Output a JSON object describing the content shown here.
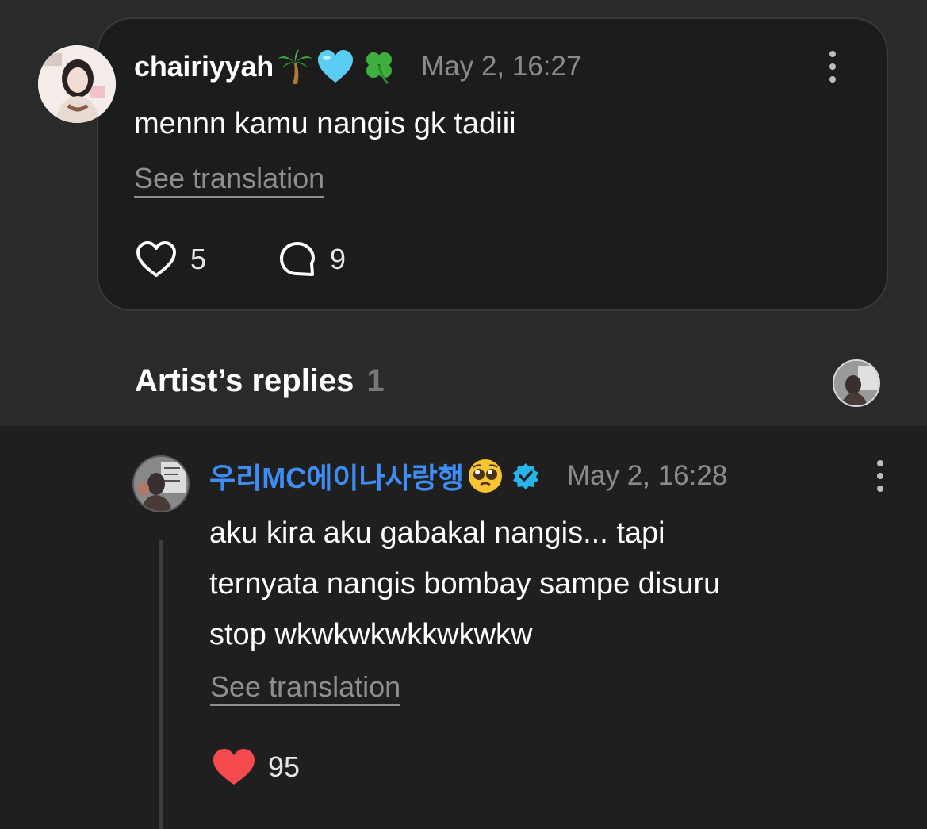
{
  "comment": {
    "username": "chairiyyah",
    "emojis": [
      "palm-tree",
      "light-blue-heart",
      "four-leaf-clover"
    ],
    "timestamp": "May 2, 16:27",
    "text": "mennn kamu nangis gk tadiii",
    "see_translation": "See translation",
    "likes": "5",
    "replies": "9"
  },
  "artist_replies": {
    "title": "Artist’s replies",
    "count": "1"
  },
  "reply": {
    "username": "우리MC에이나사랑행",
    "emoji": "pleading-face",
    "verified": true,
    "timestamp": "May 2, 16:28",
    "lines": [
      "aku kira aku gabakal nangis... tapi",
      "ternyata nangis bombay sampe disuru",
      "stop wkwkwkwkkwkwkw"
    ],
    "see_translation": "See translation",
    "likes": "95"
  },
  "colors": {
    "background": "#2a2a2a",
    "card": "#1c1c1c",
    "reply_background": "#1f1f1f",
    "artist_name": "#3d8df5",
    "verified_badge": "#27b4e8",
    "liked_heart": "#f4494d",
    "muted_text": "#8b8b8b"
  }
}
